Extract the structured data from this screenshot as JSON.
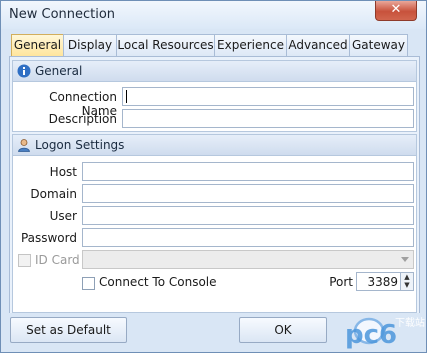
{
  "window": {
    "title": "New Connection",
    "close_glyph": "✕"
  },
  "tabs": [
    {
      "label": "General",
      "active": true
    },
    {
      "label": "Display"
    },
    {
      "label": "Local Resources"
    },
    {
      "label": "Experience"
    },
    {
      "label": "Advanced"
    },
    {
      "label": "Gateway"
    }
  ],
  "general_group": {
    "title": "General",
    "icon": "info-icon",
    "connection_name_label": "Connection Name",
    "connection_name_value": "",
    "description_label": "Description",
    "description_value": ""
  },
  "logon_group": {
    "title": "Logon Settings",
    "icon": "user-icon",
    "host_label": "Host",
    "host_value": "",
    "domain_label": "Domain",
    "domain_value": "",
    "user_label": "User",
    "user_value": "",
    "password_label": "Password",
    "password_value": "",
    "id_card_label": "ID Card",
    "id_card_checked": false,
    "id_card_enabled": false,
    "console_label": "Connect To Console",
    "console_checked": false,
    "port_label": "Port",
    "port_value": "3389"
  },
  "footer": {
    "set_default_label": "Set as Default",
    "ok_label": "OK"
  },
  "watermark": {
    "text": "pc6",
    "subtext": "下载站"
  },
  "colors": {
    "accent": "#ffe49a",
    "window_bg": "#d9e6f5",
    "close": "#c8523c"
  }
}
